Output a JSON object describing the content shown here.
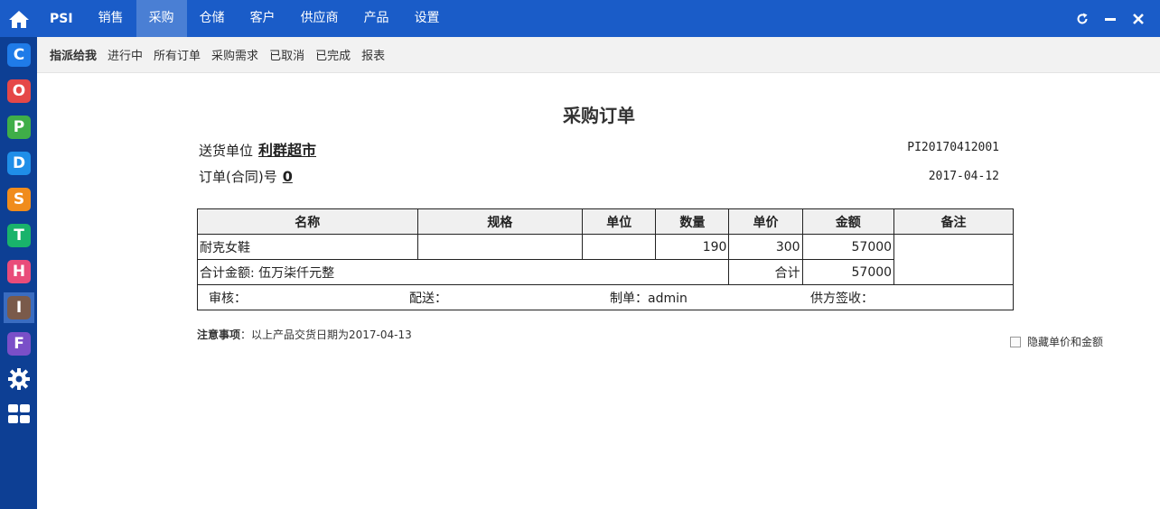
{
  "topnav": {
    "brand": "PSI",
    "items": [
      "销售",
      "采购",
      "仓储",
      "客户",
      "供应商",
      "产品",
      "设置"
    ],
    "active_index": 1
  },
  "rail": {
    "apps": [
      {
        "letter": "C",
        "color": "#1f7be8"
      },
      {
        "letter": "O",
        "color": "#e54848"
      },
      {
        "letter": "P",
        "color": "#3fae48"
      },
      {
        "letter": "D",
        "color": "#1f8ee8"
      },
      {
        "letter": "S",
        "color": "#f08c1c"
      },
      {
        "letter": "T",
        "color": "#19b36b"
      },
      {
        "letter": "H",
        "color": "#e94c7a"
      },
      {
        "letter": "I",
        "color": "#7a5a4a"
      },
      {
        "letter": "F",
        "color": "#7a4fc8"
      }
    ],
    "icons": [
      "home-icon",
      "gear-icon",
      "grid-icon"
    ]
  },
  "subnav": {
    "items": [
      "指派给我",
      "进行中",
      "所有订单",
      "采购需求",
      "已取消",
      "已完成",
      "报表"
    ],
    "active_index": 0
  },
  "order": {
    "title": "采购订单",
    "deliver_label": "送货单位",
    "deliver_value": "利群超市",
    "order_no_label": "订单(合同)号",
    "order_no_value": "0",
    "code": "PI20170412001",
    "date": "2017-04-12",
    "headers": [
      "名称",
      "规格",
      "单位",
      "数量",
      "单价",
      "金额",
      "备注"
    ],
    "rows": [
      {
        "name": "耐克女鞋",
        "spec": "",
        "unit": "",
        "qty": "190",
        "price": "300",
        "amount": "57000",
        "note": ""
      }
    ],
    "total_words": "合计金额: 伍万柒仟元整",
    "total_label": "合计",
    "total_value": "57000",
    "signatures": [
      "审核：",
      "配送：",
      "制单：admin",
      "供方签收："
    ],
    "notice_label": "注意事项",
    "notice_text": "：以上产品交货日期为2017-04-13",
    "hide_option": "隐藏单价和金额"
  }
}
